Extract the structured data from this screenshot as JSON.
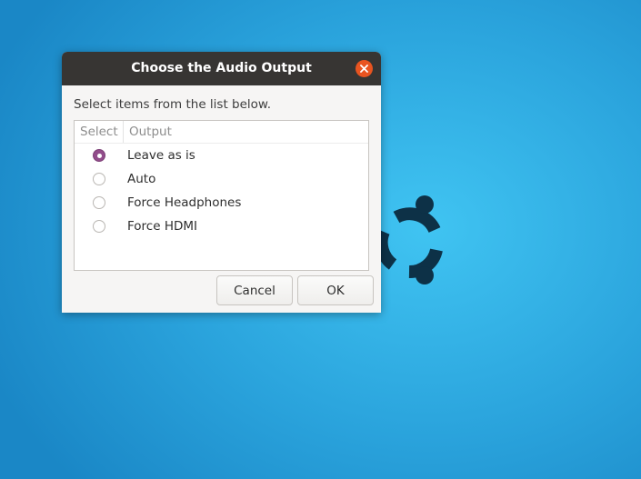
{
  "dialog": {
    "title": "Choose the Audio Output",
    "prompt": "Select items from the list below.",
    "columns": {
      "select": "Select",
      "output": "Output"
    },
    "items": [
      {
        "label": "Leave as is",
        "selected": true
      },
      {
        "label": "Auto",
        "selected": false
      },
      {
        "label": "Force Headphones",
        "selected": false
      },
      {
        "label": "Force HDMI",
        "selected": false
      }
    ],
    "buttons": {
      "cancel": "Cancel",
      "ok": "OK"
    }
  },
  "colors": {
    "accent": "#924d8b",
    "close": "#e95420",
    "titlebar": "#373533"
  },
  "icons": {
    "close": "close-icon",
    "desktop_logo": "ubuntu-logo-icon"
  }
}
